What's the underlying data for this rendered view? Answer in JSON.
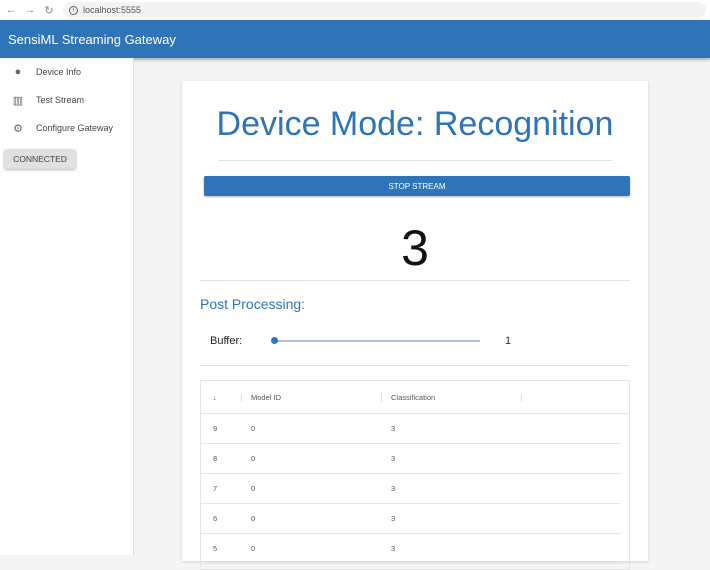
{
  "browser": {
    "url": "localhost:5555"
  },
  "app": {
    "title": "SensiML Streaming Gateway"
  },
  "sidebar": {
    "items": [
      {
        "label": "Device Info",
        "icon": "info-icon"
      },
      {
        "label": "Test Stream",
        "icon": "bar-chart-icon"
      },
      {
        "label": "Configure Gateway",
        "icon": "gear-icon"
      }
    ],
    "status": "CONNECTED"
  },
  "main": {
    "title": "Device Mode: Recognition",
    "stop_label": "STOP STREAM",
    "current_class": "3",
    "post_processing": "Post Processing:",
    "buffer_label": "Buffer:",
    "buffer_value": "1",
    "table": {
      "columns": [
        "Model ID",
        "Classification"
      ],
      "rows": [
        [
          "9",
          "0",
          "3"
        ],
        [
          "8",
          "0",
          "3"
        ],
        [
          "7",
          "0",
          "3"
        ],
        [
          "6",
          "0",
          "3"
        ],
        [
          "5",
          "0",
          "3"
        ]
      ]
    }
  }
}
